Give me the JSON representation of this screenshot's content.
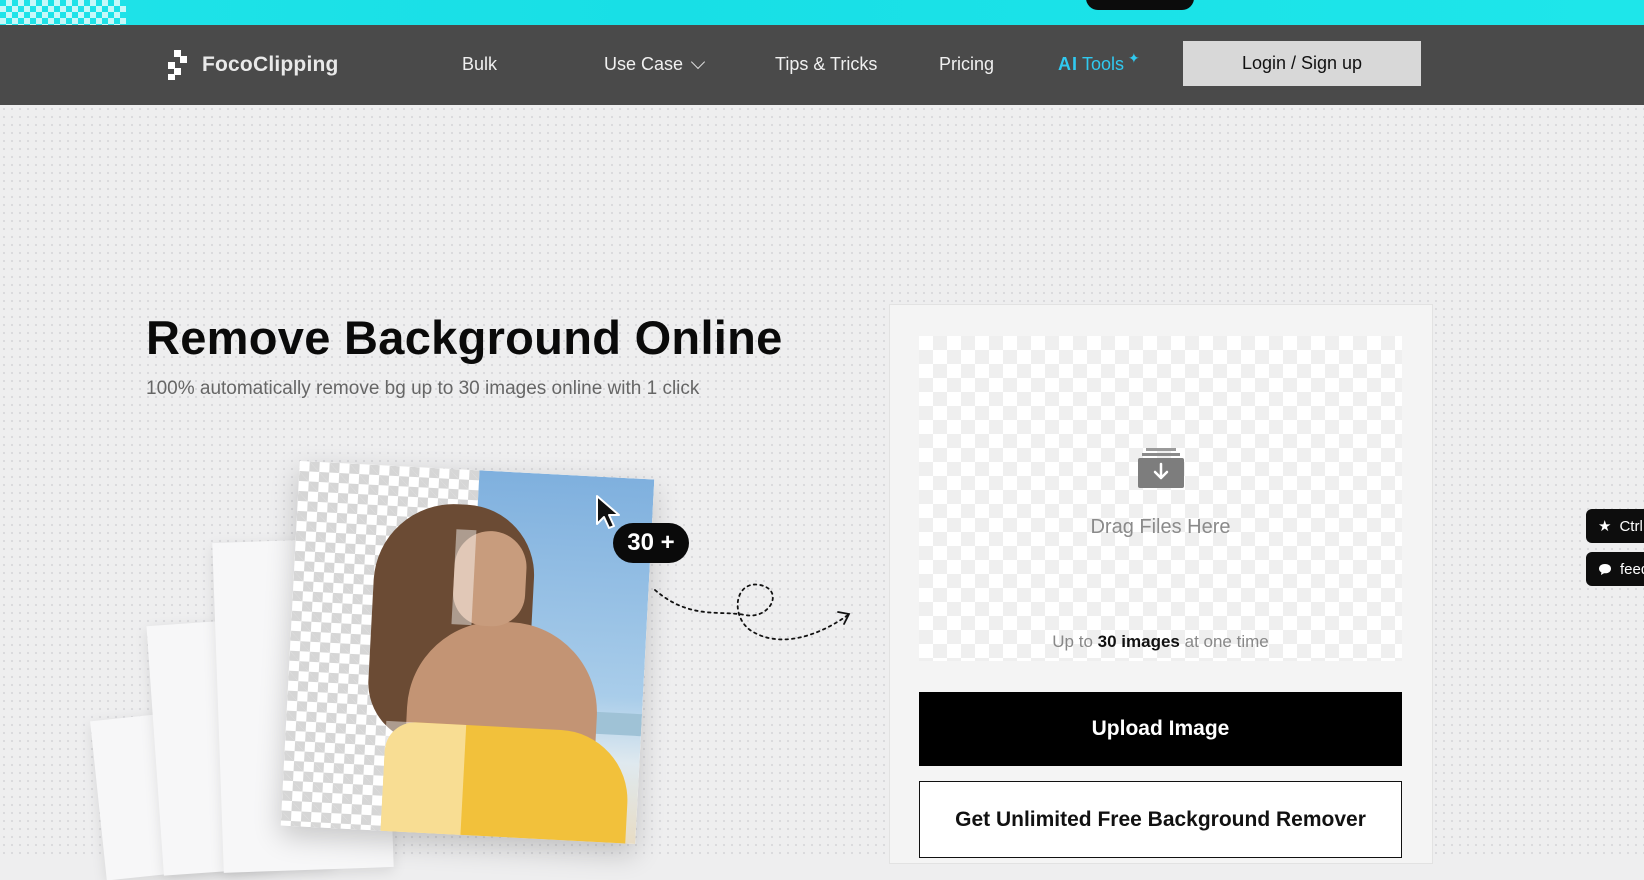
{
  "brand": {
    "name": "FocoClipping"
  },
  "nav": {
    "links": [
      {
        "label": "Bulk"
      },
      {
        "label": "Use Case"
      },
      {
        "label": "Tips & Tricks"
      },
      {
        "label": "Pricing"
      }
    ],
    "ai_tools": {
      "ai": "AI",
      "label": "Tools"
    },
    "login_label": "Login / Sign up"
  },
  "hero": {
    "title": "Remove Background Online",
    "subtitle": "100% automatically remove bg up to 30 images online with 1 click",
    "badge": "30 +"
  },
  "upload": {
    "drop_text": "Drag Files Here",
    "limit_prefix": "Up to",
    "limit_bold": "30 images",
    "limit_suffix": "at one time",
    "upload_button": "Upload Image",
    "unlimited_button": "Get Unlimited Free Background Remover"
  },
  "side_tabs": [
    {
      "label": "Ctrl",
      "icon": "star-icon"
    },
    {
      "label": "feed",
      "icon": "chat-bubble-icon"
    }
  ],
  "colors": {
    "promo_cyan": "#1fe3e8",
    "nav_bg": "#4a4a4a",
    "ai_accent": "#30c9f0",
    "primary_button": "#000000"
  }
}
